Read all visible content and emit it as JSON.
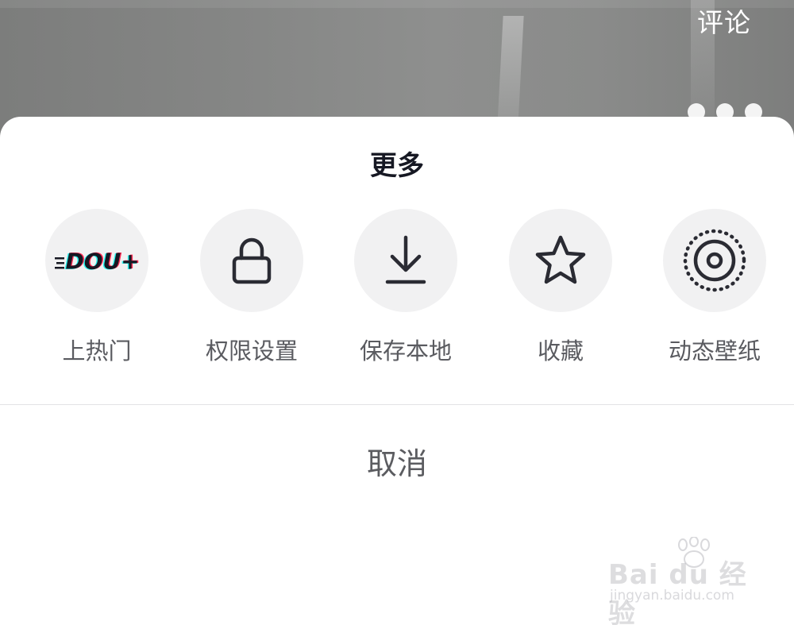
{
  "video": {
    "comment_label": "评论"
  },
  "sheet": {
    "title": "更多",
    "actions": [
      {
        "label": "上热门",
        "icon": "dou-plus-icon"
      },
      {
        "label": "权限设置",
        "icon": "lock-icon"
      },
      {
        "label": "保存本地",
        "icon": "download-icon"
      },
      {
        "label": "收藏",
        "icon": "star-icon"
      },
      {
        "label": "动态壁纸",
        "icon": "wallpaper-icon"
      }
    ],
    "cancel_label": "取消"
  },
  "dou_plus_logo_text": "DOU+",
  "watermark": {
    "brand": "Bai du 经验",
    "url": "jingyan.baidu.com"
  },
  "colors": {
    "title": "#161823",
    "label": "#5a5b60",
    "icon_bg": "#f1f1f2",
    "icon_stroke": "#2a2b33",
    "dou_red": "#fe2c55",
    "dou_cyan": "#25f4ee"
  }
}
